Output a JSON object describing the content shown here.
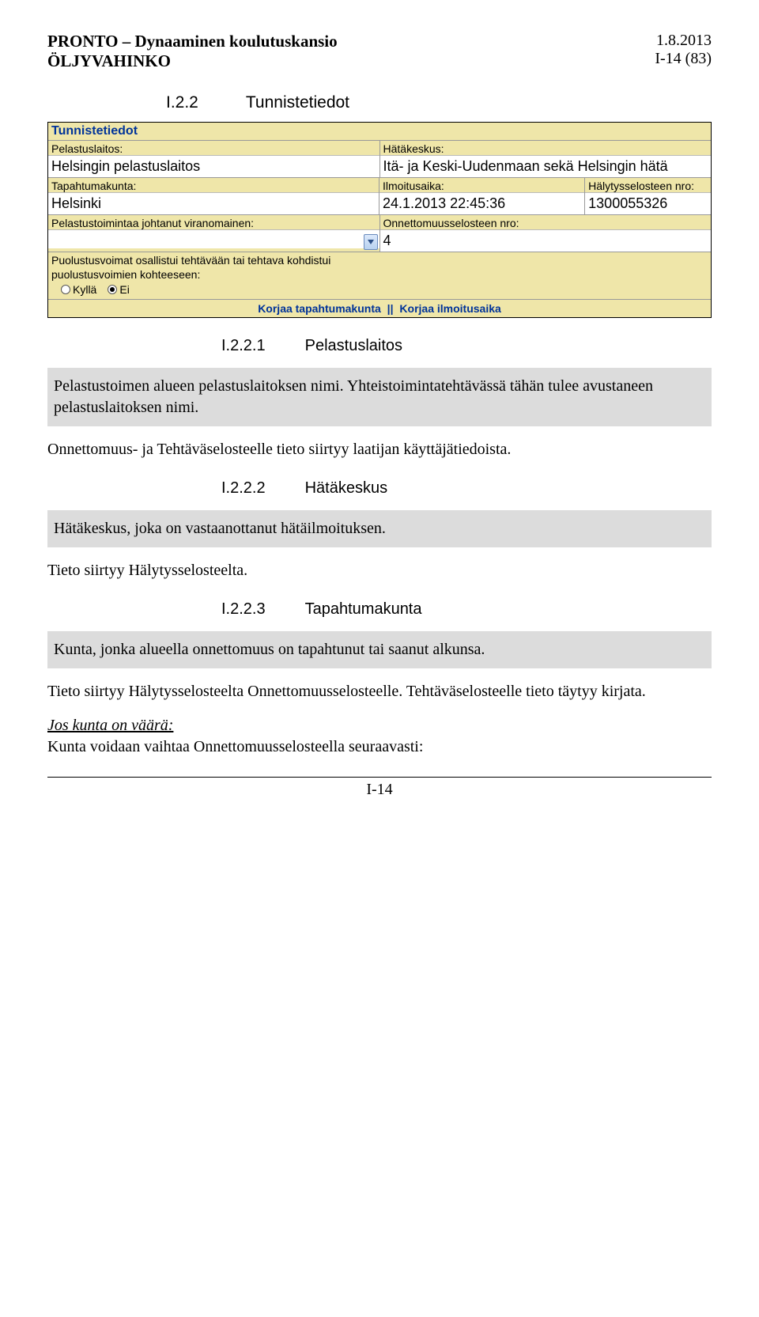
{
  "header": {
    "title_line1": "PRONTO – Dynaaminen koulutuskansio",
    "title_line2": "ÖLJYVAHINKO",
    "date": "1.8.2013",
    "page_ref": "I-14 (83)"
  },
  "section": {
    "num": "I.2.2",
    "title": "Tunnistetiedot"
  },
  "form": {
    "title": "Tunnistetiedot",
    "pelastuslaitos_label": "Pelastuslaitos:",
    "pelastuslaitos_value": "Helsingin pelastuslaitos",
    "hatakeskus_label": "Hätäkeskus:",
    "hatakeskus_value": "Itä- ja Keski-Uudenmaan sekä Helsingin hätä",
    "tapahtumakunta_label": "Tapahtumakunta:",
    "tapahtumakunta_value": "Helsinki",
    "ilmoitusaika_label": "Ilmoitusaika:",
    "ilmoitusaika_value": "24.1.2013 22:45:36",
    "halytys_label": "Hälytysselosteen nro:",
    "halytys_value": "1300055326",
    "pelastustoimintaa_label": "Pelastustoimintaa johtanut viranomainen:",
    "pelastustoimintaa_value": "",
    "onnettomuus_label": "Onnettomuusselosteen nro:",
    "onnettomuus_value": "4",
    "puolustus_label_line1": "Puolustusvoimat osallistui tehtävään tai tehtava kohdistui",
    "puolustus_label_line2": "puolustusvoimien kohteeseen:",
    "radio_yes": "Kyllä",
    "radio_no": "Ei",
    "link1": "Korjaa tapahtumakunta",
    "link_sep": "||",
    "link2": "Korjaa ilmoitusaika"
  },
  "sub1": {
    "num": "I.2.2.1",
    "title": "Pelastuslaitos"
  },
  "box1": "Pelastustoimen alueen pelastuslaitoksen nimi. Yhteistoimintatehtävässä tähän tulee avustaneen pelastuslaitoksen nimi.",
  "p1": "Onnettomuus- ja Tehtäväselosteelle tieto siirtyy laatijan käyttäjätiedoista.",
  "sub2": {
    "num": "I.2.2.2",
    "title": "Hätäkeskus"
  },
  "box2": "Hätäkeskus, joka on vastaanottanut hätäilmoituksen.",
  "p2": "Tieto siirtyy Hälytysselosteelta.",
  "sub3": {
    "num": "I.2.2.3",
    "title": "Tapahtumakunta"
  },
  "box3": "Kunta, jonka alueella onnettomuus on tapahtunut tai saanut alkunsa.",
  "p3": "Tieto siirtyy Hälytysselosteelta Onnettomuusselosteelle. Tehtäväselosteelle tieto täytyy kirjata.",
  "p4_lead": "Jos kunta on väärä:",
  "p4_rest": "Kunta voidaan vaihtaa Onnettomuusselosteella seuraavasti:",
  "footer": "I-14"
}
